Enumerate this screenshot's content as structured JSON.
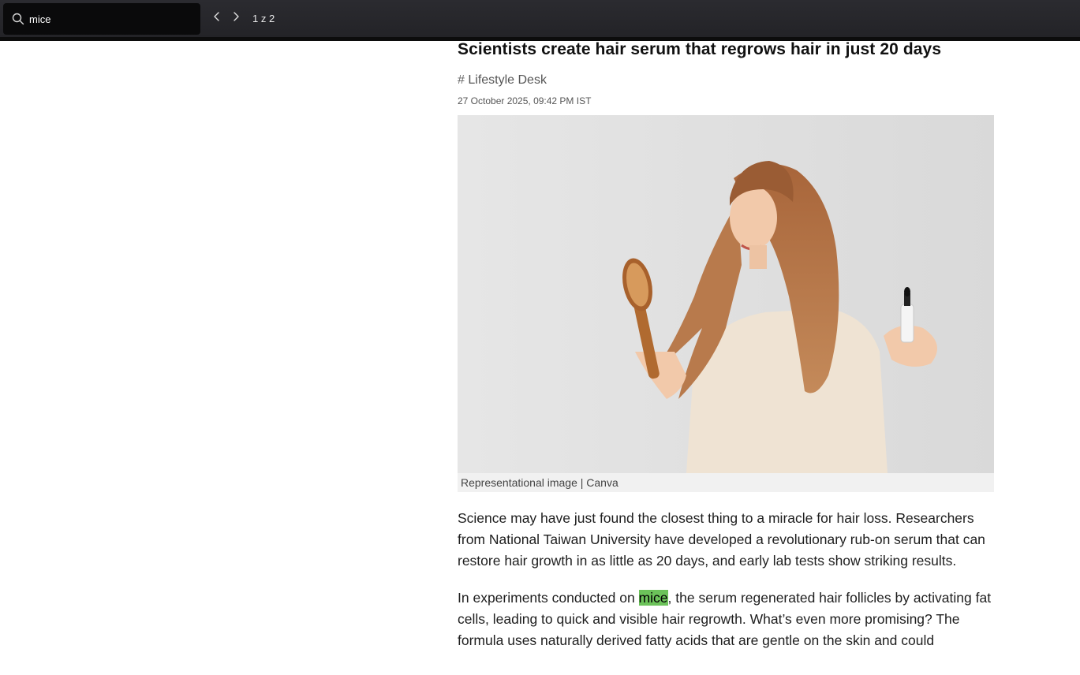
{
  "find_bar": {
    "query": "mice",
    "match_count": "1 z 2",
    "icons": {
      "search": "search-icon",
      "prev": "chevron-left-icon",
      "next": "chevron-right-icon"
    }
  },
  "article": {
    "headline": "Scientists create hair serum that regrows hair in just 20 days",
    "desk_hash": "#",
    "desk": "Lifestyle Desk",
    "date": "27 October 2025, 09:42 PM IST",
    "image_caption": "Representational image | Canva",
    "paragraph1": "Science may have just found the closest thing to a miracle for hair loss. Researchers from National Taiwan University have developed a revolutionary rub-on serum that can restore hair growth in as little as 20 days, and early lab tests show striking results.",
    "paragraph2_before": "In experiments conducted on ",
    "paragraph2_highlight": "mice",
    "paragraph2_after": ", the serum regenerated hair follicles by activating fat cells, leading to quick and visible hair regrowth. What’s even more promising? The formula uses naturally derived fatty acids that are gentle on the skin and could"
  },
  "colors": {
    "findbar_bg": "#2b2b30",
    "input_bg": "#0a0a0b",
    "highlight": "#6cc35a"
  }
}
